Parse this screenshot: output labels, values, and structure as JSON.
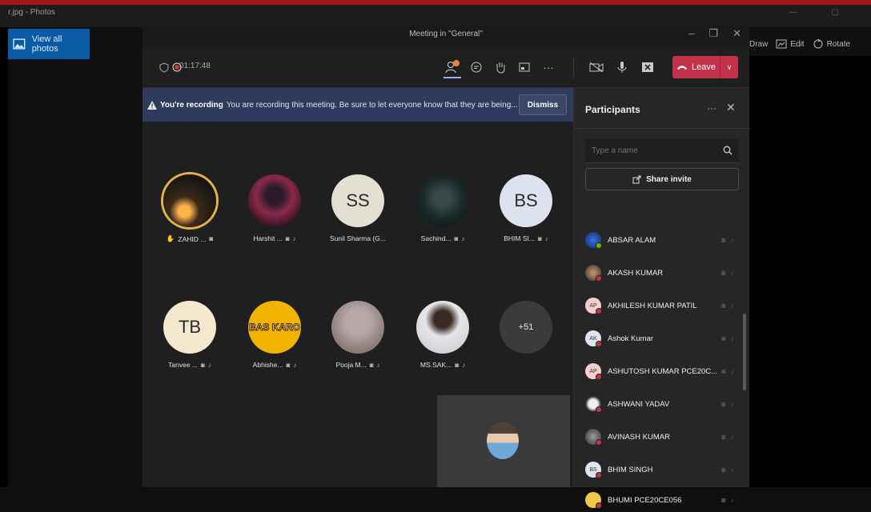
{
  "photos": {
    "title": "r.jpg - Photos",
    "view_all": "View all photos",
    "toolbar": {
      "draw": "Draw",
      "edit": "Edit",
      "rotate": "Rotate"
    }
  },
  "teams": {
    "window_title": "Meeting in \"General\"",
    "timer": "01:17:48",
    "leave_label": "Leave",
    "recording": {
      "title": "You're recording",
      "message": "You are recording this meeting. Be sure to let everyone know that they are being...",
      "dismiss": "Dismiss"
    },
    "tiles": [
      {
        "label": "ZAHID ...",
        "initials": ""
      },
      {
        "label": "Harshit ...",
        "initials": ""
      },
      {
        "label": "Sunil Sharma (G...",
        "initials": "SS"
      },
      {
        "label": "Sachind...",
        "initials": ""
      },
      {
        "label": "BHIM SI...",
        "initials": "BS"
      },
      {
        "label": "Tanvee ...",
        "initials": "TB"
      },
      {
        "label": "Abhishe...",
        "initials": "BAS KARO"
      },
      {
        "label": "Pooja M...",
        "initials": ""
      },
      {
        "label": "MS.SAK...",
        "initials": ""
      },
      {
        "label": "",
        "initials": "+51"
      }
    ],
    "participants": {
      "title": "Participants",
      "search_placeholder": "Type a name",
      "share_invite": "Share invite",
      "people": [
        {
          "name": "ABSAR ALAM",
          "initials": ""
        },
        {
          "name": "AKASH KUMAR",
          "initials": ""
        },
        {
          "name": "AKHILESH KUMAR PATIL",
          "initials": "AP"
        },
        {
          "name": "Ashok Kumar",
          "initials": "AK"
        },
        {
          "name": "ASHUTOSH KUMAR PCE20C...",
          "initials": "AP"
        },
        {
          "name": "ASHWANI YADAV",
          "initials": ""
        },
        {
          "name": "AVINASH KUMAR",
          "initials": ""
        },
        {
          "name": "BHIM SINGH",
          "initials": "BS"
        },
        {
          "name": "BHUMI PCE20CE056",
          "initials": ""
        }
      ]
    }
  },
  "colors": {
    "leave": "#c4314b",
    "banner": "#2f3b5c",
    "photos_accent": "#0b5aa5"
  }
}
